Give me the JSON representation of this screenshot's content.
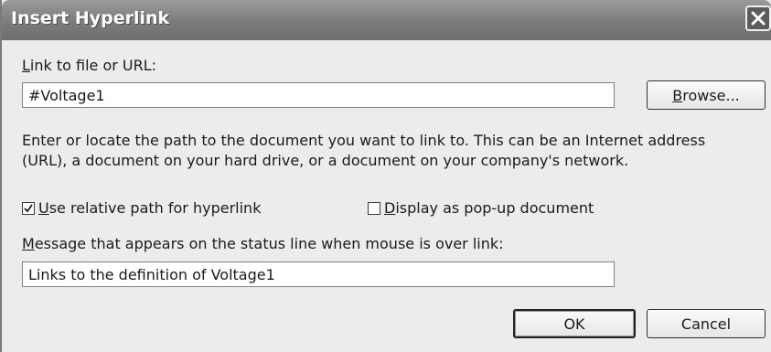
{
  "dialog": {
    "title": "Insert Hyperlink",
    "link_label_key": "L",
    "link_label_rest": "ink to file or URL:",
    "link_value": "#Voltage1",
    "browse_key": "B",
    "browse_rest": "rowse...",
    "description": "Enter or locate the path to the document you want to link to. This can be an Internet address (URL), a document on your hard drive, or a document on your company's network.",
    "relative_path": {
      "checked": true,
      "label_key": "U",
      "label_rest": "se relative path for hyperlink"
    },
    "popup": {
      "checked": false,
      "label_key": "D",
      "label_rest": "isplay as pop-up document"
    },
    "message_label_key": "M",
    "message_label_rest": "essage that appears on the status line when mouse is over link:",
    "message_value": "Links to the definition of Voltage1",
    "ok_label": "OK",
    "cancel_label": "Cancel"
  },
  "icons": {
    "close": "close-icon",
    "check": "checkmark-icon"
  }
}
